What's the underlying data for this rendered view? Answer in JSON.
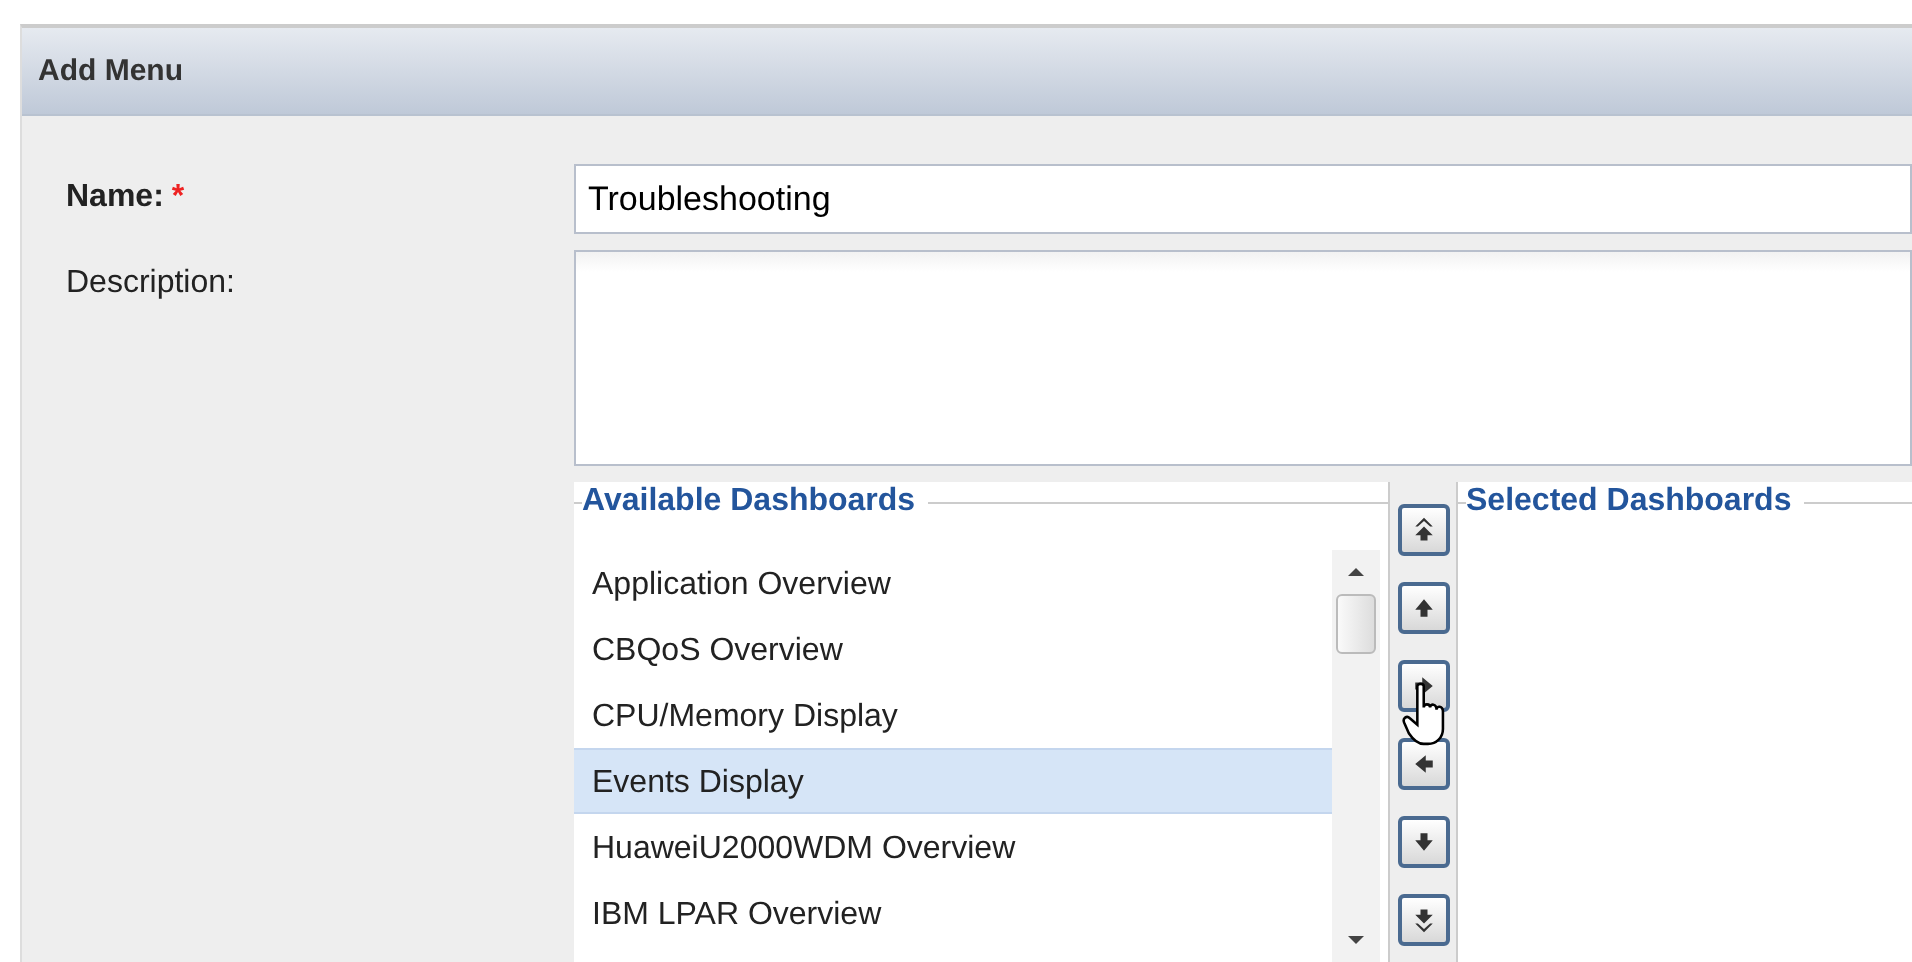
{
  "panel": {
    "title": "Add Menu"
  },
  "form": {
    "name_label": "Name:",
    "required_mark": "*",
    "name_value": "Troubleshooting",
    "description_label": "Description:"
  },
  "available": {
    "title": "Available Dashboards",
    "items": [
      {
        "label": "Application Overview",
        "selected": false
      },
      {
        "label": "CBQoS Overview",
        "selected": false
      },
      {
        "label": "CPU/Memory Display",
        "selected": false
      },
      {
        "label": "Events Display",
        "selected": true
      },
      {
        "label": "HuaweiU2000WDM Overview",
        "selected": false
      },
      {
        "label": "IBM LPAR Overview",
        "selected": false
      }
    ]
  },
  "move_buttons": [
    {
      "kind": "top"
    },
    {
      "kind": "up"
    },
    {
      "kind": "right"
    },
    {
      "kind": "left"
    },
    {
      "kind": "down"
    },
    {
      "kind": "bottom"
    }
  ],
  "selected_dashboards": {
    "title": "Selected Dashboards"
  }
}
